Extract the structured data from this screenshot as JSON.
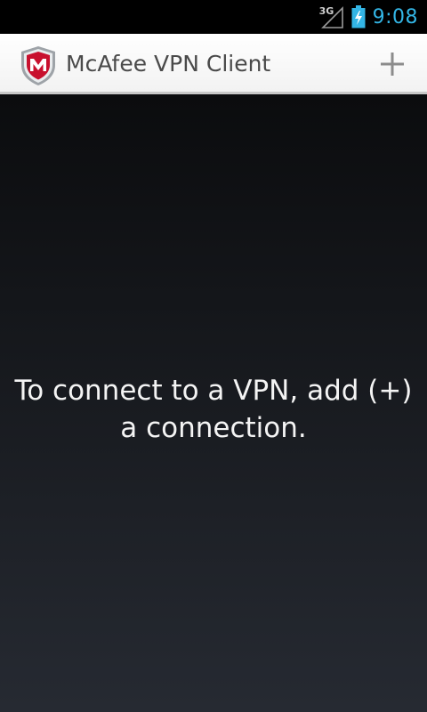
{
  "status_bar": {
    "network_type": "3G",
    "time": "9:08",
    "icons": [
      "signal-icon",
      "battery-charging-icon"
    ]
  },
  "action_bar": {
    "title": "McAfee VPN Client",
    "logo_icon": "mcafee-shield-icon",
    "add_icon": "plus-icon"
  },
  "main": {
    "empty_message": "To connect to a VPN, add (+) a connection."
  },
  "colors": {
    "clock": "#33b5e5",
    "logo_red": "#c8102e",
    "action_bar_bg": "#ffffff",
    "content_bg_top": "#0b0c0e",
    "content_bg_bottom": "#262a32"
  }
}
